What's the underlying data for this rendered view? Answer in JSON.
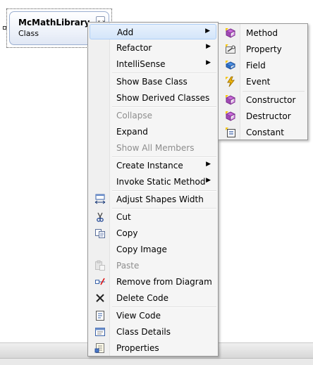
{
  "class_shape": {
    "name": "McMathLibrary",
    "kind": "Class",
    "collapse_glyph": "⌄⌄"
  },
  "menu": {
    "items": [
      {
        "label": "Add",
        "submenu": true,
        "highlighted": true
      },
      {
        "label": "Refactor",
        "submenu": true
      },
      {
        "label": "IntelliSense",
        "submenu": true
      },
      {
        "label": "Show Base Class"
      },
      {
        "label": "Show Derived Classes"
      },
      {
        "label": "Collapse",
        "disabled": true
      },
      {
        "label": "Expand"
      },
      {
        "label": "Show All Members",
        "disabled": true
      },
      {
        "label": "Create Instance",
        "submenu": true
      },
      {
        "label": "Invoke Static Method",
        "submenu": true
      },
      {
        "label": "Adjust Shapes Width",
        "icon": "adjust-width-icon"
      },
      {
        "label": "Cut",
        "icon": "scissors-icon"
      },
      {
        "label": "Copy",
        "icon": "copy-icon"
      },
      {
        "label": "Copy Image"
      },
      {
        "label": "Paste",
        "icon": "paste-icon",
        "disabled": true
      },
      {
        "label": "Remove from Diagram",
        "icon": "remove-from-diagram-icon"
      },
      {
        "label": "Delete Code",
        "icon": "delete-x-icon"
      },
      {
        "label": "View Code",
        "icon": "view-code-icon"
      },
      {
        "label": "Class Details",
        "icon": "class-details-icon"
      },
      {
        "label": "Properties",
        "icon": "properties-icon"
      }
    ],
    "arrow_glyph": "▶"
  },
  "submenu": {
    "items": [
      {
        "label": "Method",
        "icon": "method-icon"
      },
      {
        "label": "Property",
        "icon": "property-icon"
      },
      {
        "label": "Field",
        "icon": "field-icon"
      },
      {
        "label": "Event",
        "icon": "event-icon"
      },
      {
        "label": "Constructor",
        "icon": "constructor-icon"
      },
      {
        "label": "Destructor",
        "icon": "destructor-icon"
      },
      {
        "label": "Constant",
        "icon": "constant-icon"
      }
    ]
  },
  "colors": {
    "highlight_border": "#aecff7",
    "menu_bg": "#f5f5f5",
    "disabled_text": "#8d8d8d"
  }
}
